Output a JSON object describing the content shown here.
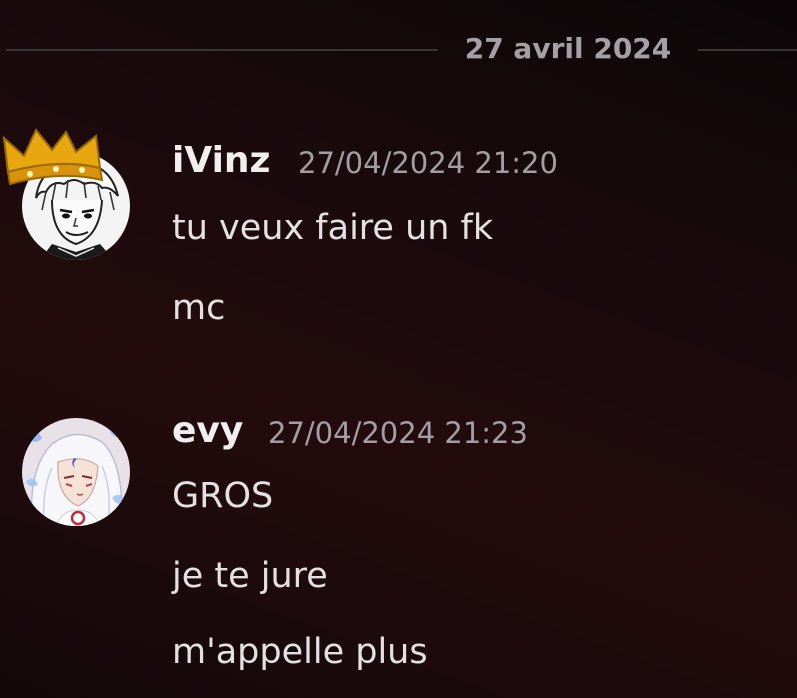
{
  "date_divider": "27 avril 2024",
  "groups": [
    {
      "username": "iVinz",
      "timestamp": "27/04/2024 21:20",
      "avatar_icon": "manga-boy-with-crown-avatar",
      "messages": [
        "tu veux faire un fk",
        "mc"
      ]
    },
    {
      "username": "evy",
      "timestamp": "27/04/2024 21:23",
      "avatar_icon": "anime-white-haired-character-avatar",
      "messages": [
        "GROS",
        "je te jure",
        "m'appelle plus"
      ]
    }
  ],
  "colors": {
    "username": "#f0eeef",
    "timestamp": "#a29ea3",
    "message": "#e4e1e2",
    "divider_text": "#a4a0a5",
    "crown": "#e9a70f"
  }
}
